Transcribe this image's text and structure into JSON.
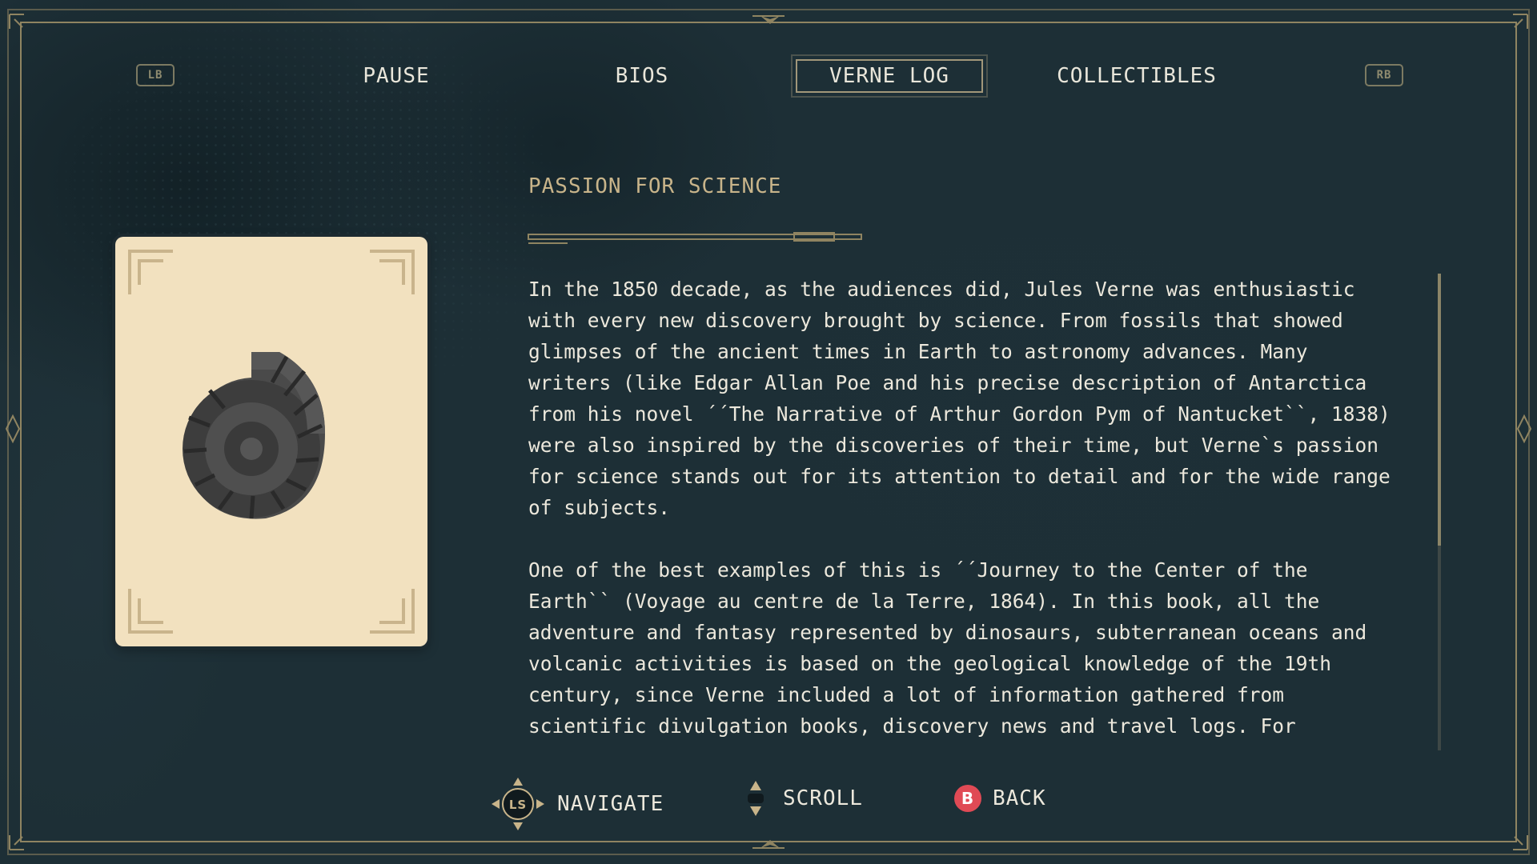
{
  "nav": {
    "left_bumper": "LB",
    "right_bumper": "RB",
    "tabs": [
      {
        "label": "PAUSE"
      },
      {
        "label": "BIOS"
      },
      {
        "label": "VERNE LOG",
        "active": true
      },
      {
        "label": "COLLECTIBLES"
      }
    ]
  },
  "entry": {
    "title": "PASSION FOR SCIENCE",
    "image_icon": "ammonite-fossil-icon",
    "paragraphs": [
      "In the 1850 decade, as the audiences did, Jules Verne was enthusiastic with every new discovery brought by science. From fossils that showed glimpses of the ancient times in Earth to astronomy advances. Many writers (like Edgar Allan Poe and his precise description of Antarctica from his novel ´´The Narrative of Arthur Gordon Pym of Nantucket``, 1838) were also inspired by the discoveries of their time, but Verne`s passion for science stands out for its attention to detail and for the wide range of subjects.",
      "One of the best examples of this is ´´Journey to the Center of the Earth`` (Voyage au centre de la Terre, 1864). In this book, all the adventure and fantasy represented by dinosaurs, subterranean oceans and volcanic activities is based on the geological knowledge of the 19th century, since Verne included a lot of information gathered from scientific divulgation books, discovery news and travel logs. For instance, the spectacular"
    ]
  },
  "hints": {
    "navigate_label": "NAVIGATE",
    "navigate_stick": "LS",
    "scroll_label": "SCROLL",
    "back_label": "BACK",
    "back_button": "B"
  },
  "colors": {
    "background": "#1d2f36",
    "frame_gold": "#8f8461",
    "card_paper": "#f2e1bf",
    "accent_title": "#c8b48a",
    "back_button_red": "#e04a55"
  }
}
